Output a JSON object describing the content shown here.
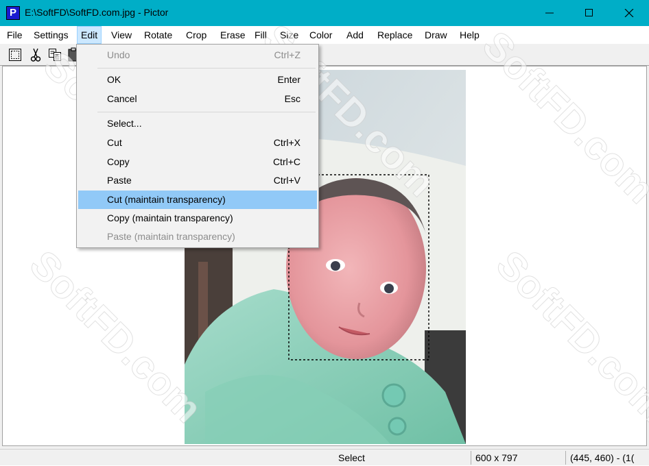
{
  "window": {
    "title": "E:\\SoftFD\\SoftFD.com.jpg - Pictor",
    "app_icon_letter": "P"
  },
  "menubar": {
    "items": [
      "File",
      "Settings",
      "Edit",
      "View",
      "Rotate",
      "Crop",
      "Erase",
      "Fill",
      "Size",
      "Color",
      "Add",
      "Replace",
      "Draw",
      "Help"
    ],
    "active": "Edit"
  },
  "edit_menu": {
    "items": [
      {
        "label": "Undo",
        "shortcut": "Ctrl+Z",
        "state": "disabled"
      },
      {
        "label": "OK",
        "shortcut": "Enter",
        "state": "normal"
      },
      {
        "label": "Cancel",
        "shortcut": "Esc",
        "state": "normal"
      },
      {
        "label": "Select...",
        "shortcut": "",
        "state": "normal"
      },
      {
        "label": "Cut",
        "shortcut": "Ctrl+X",
        "state": "normal"
      },
      {
        "label": "Copy",
        "shortcut": "Ctrl+C",
        "state": "normal"
      },
      {
        "label": "Paste",
        "shortcut": "Ctrl+V",
        "state": "normal"
      },
      {
        "label": "Cut (maintain transparency)",
        "shortcut": "",
        "state": "highlighted"
      },
      {
        "label": "Copy (maintain transparency)",
        "shortcut": "",
        "state": "normal"
      },
      {
        "label": "Paste (maintain transparency)",
        "shortcut": "",
        "state": "disabled"
      }
    ]
  },
  "toolbar": {
    "icons": [
      "select-rect-icon",
      "scissors-icon",
      "copy-icon",
      "paste-icon"
    ]
  },
  "status": {
    "mode": "Select",
    "image_size": "600 x 797",
    "cursor": "(445, 460) - (1("
  },
  "watermark_text": "SoftFD.com",
  "colors": {
    "titlebar": "#00aec7",
    "menu_highlight": "#91c9f7",
    "active_menu": "#cce8ff"
  }
}
